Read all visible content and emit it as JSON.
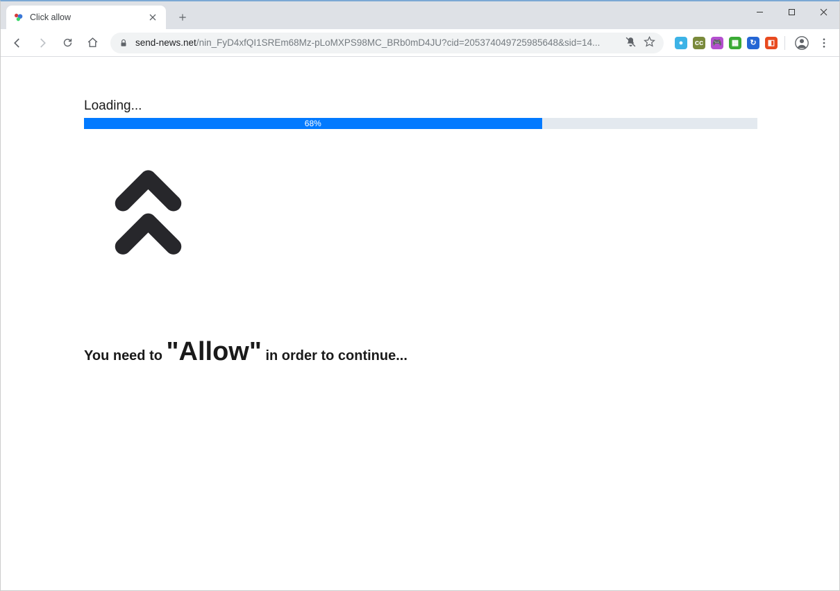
{
  "window": {
    "tab": {
      "title": "Click allow"
    },
    "url": {
      "domain": "send-news.net",
      "path": "/nin_FyD4xfQI1SREm68Mz-pLoMXPS98MC_BRb0mD4JU?cid=205374049725985648&sid=14..."
    }
  },
  "extensions": [
    {
      "name": "ext-search",
      "color": "#3db3e6",
      "glyph": "●"
    },
    {
      "name": "ext-cc",
      "color": "#7a8a3b",
      "glyph": "cc"
    },
    {
      "name": "ext-game",
      "color": "#b44fcf",
      "glyph": "🎮"
    },
    {
      "name": "ext-green",
      "color": "#3aaa35",
      "glyph": "▦"
    },
    {
      "name": "ext-sync",
      "color": "#2566d4",
      "glyph": "↻"
    },
    {
      "name": "ext-orange",
      "color": "#e84a1f",
      "glyph": "◧"
    }
  ],
  "page": {
    "loadingLabel": "Loading...",
    "progressPercent": 68,
    "progressText": "68%",
    "message": {
      "pre": "You need to ",
      "allow": "\"Allow\"",
      "post": " in order to continue..."
    }
  }
}
